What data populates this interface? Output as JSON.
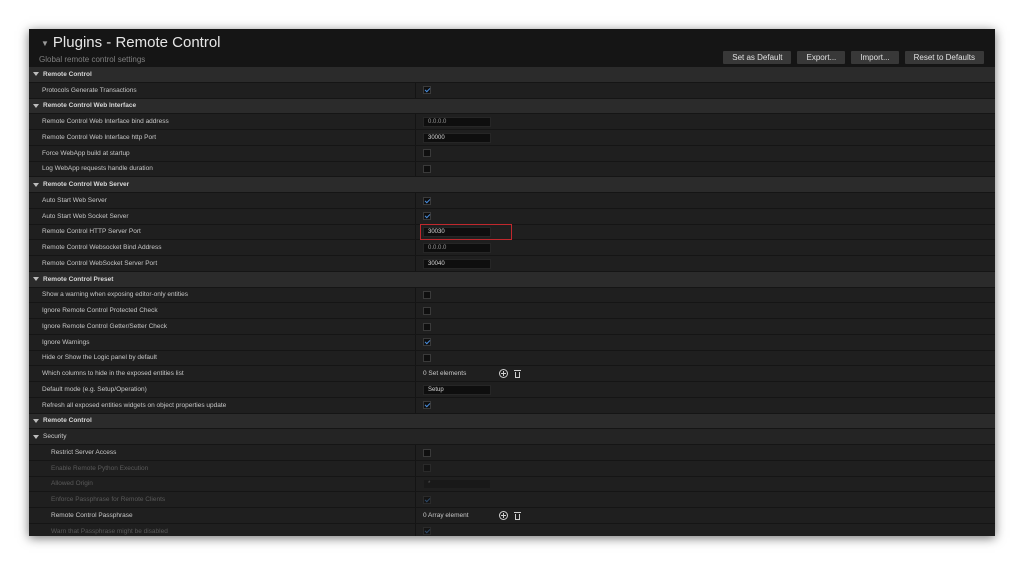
{
  "header": {
    "title": "Plugins - Remote Control",
    "subtitle": "Global remote control settings",
    "buttons": [
      "Set as Default",
      "Export...",
      "Import...",
      "Reset to Defaults"
    ]
  },
  "sections": {
    "remote_control": {
      "title": "Remote Control",
      "props": [
        {
          "label": "Protocols Generate Transactions",
          "checked": true
        }
      ]
    },
    "web_interface": {
      "title": "Remote Control Web Interface",
      "props": [
        {
          "label": "Remote Control Web Interface bind address",
          "value": "0.0.0.0"
        },
        {
          "label": "Remote Control Web Interface http Port",
          "value": "30000"
        },
        {
          "label": "Force WebApp build at startup",
          "checked": false
        },
        {
          "label": "Log WebApp requests handle duration",
          "checked": false
        }
      ]
    },
    "web_server": {
      "title": "Remote Control Web Server",
      "props": [
        {
          "label": "Auto Start Web Server",
          "checked": true
        },
        {
          "label": "Auto Start Web Socket Server",
          "checked": true
        },
        {
          "label": "Remote Control HTTP Server Port",
          "value": "30030"
        },
        {
          "label": "Remote Control Websocket Bind Address",
          "value": "0.0.0.0"
        },
        {
          "label": "Remote Control WebSocket Server Port",
          "value": "30040"
        }
      ]
    },
    "preset": {
      "title": "Remote Control Preset",
      "props": [
        {
          "label": "Show a warning when exposing editor-only entities",
          "checked": false
        },
        {
          "label": "Ignore Remote Control Protected Check",
          "checked": false
        },
        {
          "label": "Ignore Remote Control Getter/Setter Check",
          "checked": false
        },
        {
          "label": "Ignore Warnings",
          "checked": true
        },
        {
          "label": "Hide or Show the Logic panel by default",
          "checked": false
        },
        {
          "label": "Which columns to hide in the exposed entities list",
          "value": "0 Set elements"
        },
        {
          "label": "Default mode (e.g. Setup/Operation)",
          "value": "Setup"
        },
        {
          "label": "Refresh all exposed entities widgets on object properties update",
          "checked": true
        }
      ]
    },
    "remote_control_2": {
      "title": "Remote Control",
      "security": {
        "title": "Security",
        "props": [
          {
            "label": "Restrict Server Access",
            "checked": false
          },
          {
            "label": "Enable Remote Python Execution",
            "checked": false
          },
          {
            "label": "Allowed Origin",
            "value": "*"
          },
          {
            "label": "Enforce Passphrase for Remote Clients",
            "checked": true
          },
          {
            "label": "Remote Control Passphrase",
            "value": "0 Array element"
          },
          {
            "label": "Warn that Passphrase might be disabled",
            "checked": true
          }
        ]
      }
    }
  },
  "colors": {
    "highlight": "#c0282d",
    "check": "#4a8fe0",
    "background": "#1a1a1a"
  }
}
